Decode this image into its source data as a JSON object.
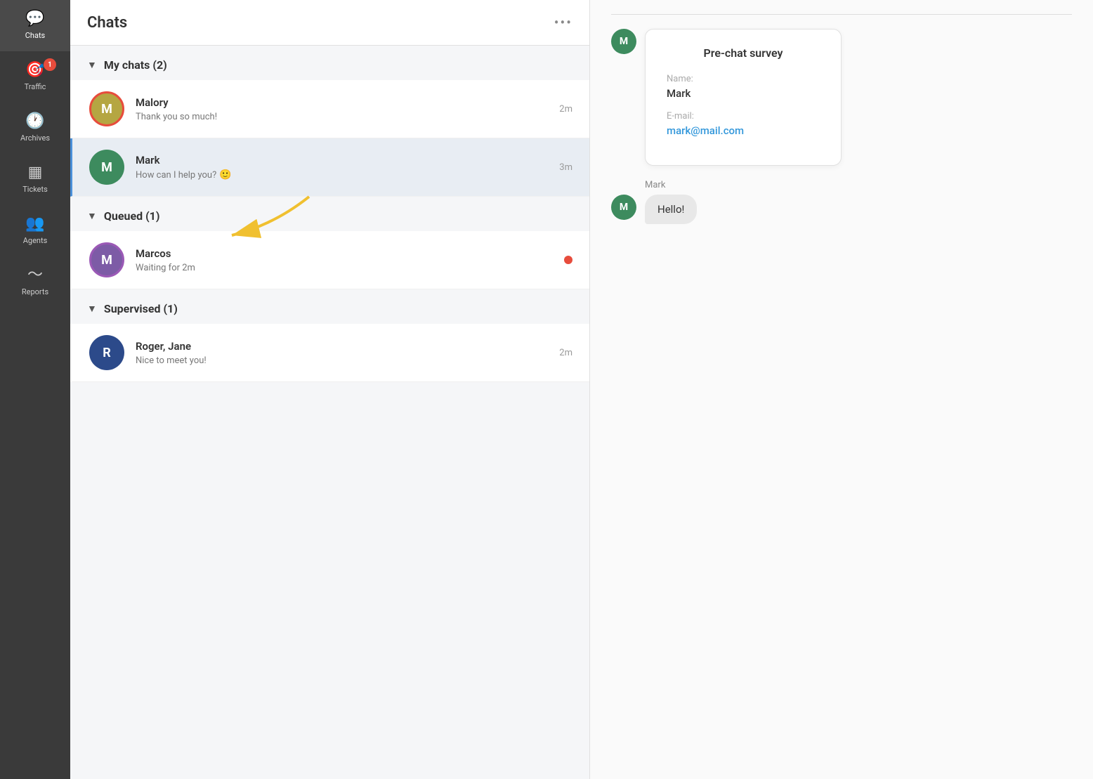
{
  "sidebar": {
    "items": [
      {
        "id": "chats",
        "label": "Chats",
        "icon": "💬",
        "active": true,
        "badge": null
      },
      {
        "id": "traffic",
        "label": "Traffic",
        "icon": "🎯",
        "active": false,
        "badge": "1"
      },
      {
        "id": "archives",
        "label": "Archives",
        "icon": "🕐",
        "active": false,
        "badge": null
      },
      {
        "id": "tickets",
        "label": "Tickets",
        "icon": "🎫",
        "active": false,
        "badge": null
      },
      {
        "id": "agents",
        "label": "Agents",
        "icon": "👥",
        "active": false,
        "badge": null
      },
      {
        "id": "reports",
        "label": "Reports",
        "icon": "📈",
        "active": false,
        "badge": null
      }
    ]
  },
  "chat_list": {
    "title": "Chats",
    "more_icon": "•••",
    "sections": [
      {
        "id": "my-chats",
        "label": "My chats (2)",
        "expanded": true,
        "items": [
          {
            "id": "malory",
            "name": "Malory",
            "preview": "Thank you so much!",
            "time": "2m",
            "avatar_letter": "M",
            "avatar_color": "olive",
            "ring": "red",
            "selected": false,
            "dot": false
          },
          {
            "id": "mark",
            "name": "Mark",
            "preview": "How can I help you?",
            "preview_emoji": "🙂",
            "time": "3m",
            "avatar_letter": "M",
            "avatar_color": "green",
            "ring": null,
            "selected": true,
            "dot": false
          }
        ]
      },
      {
        "id": "queued",
        "label": "Queued (1)",
        "expanded": true,
        "items": [
          {
            "id": "marcos",
            "name": "Marcos",
            "preview": "Waiting for 2m",
            "time": null,
            "avatar_letter": "M",
            "avatar_color": "purple",
            "ring": "red",
            "selected": false,
            "dot": true
          }
        ]
      },
      {
        "id": "supervised",
        "label": "Supervised (1)",
        "expanded": true,
        "items": [
          {
            "id": "roger-jane",
            "name": "Roger, Jane",
            "preview": "Nice to meet you!",
            "time": "2m",
            "avatar_letter": "R",
            "avatar_color": "navy",
            "ring": null,
            "selected": false,
            "dot": false
          }
        ]
      }
    ]
  },
  "right_panel": {
    "survey": {
      "title": "Pre-chat survey",
      "fields": [
        {
          "label": "Name:",
          "value": "Mark",
          "is_email": false
        },
        {
          "label": "E-mail:",
          "value": "mark@mail.com",
          "is_email": true
        }
      ]
    },
    "message": {
      "sender": "Mark",
      "avatar_letter": "M",
      "bubble_text": "Hello!"
    }
  }
}
